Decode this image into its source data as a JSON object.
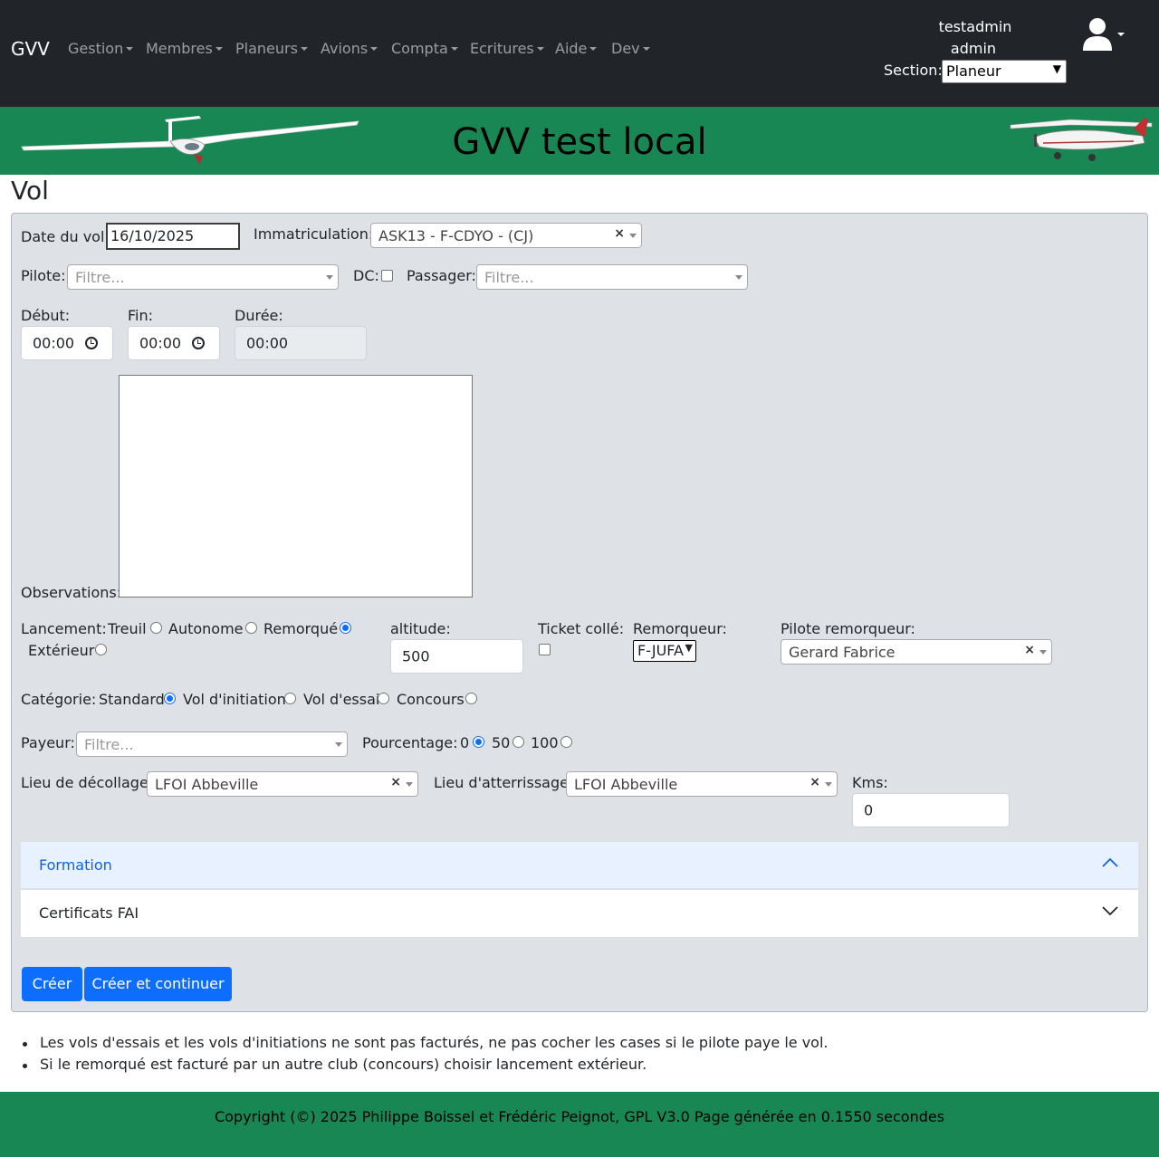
{
  "nav": {
    "brand": "GVV",
    "menus": [
      "Gestion",
      "Membres",
      "Planeurs",
      "Avions",
      "Compta",
      "Ecritures",
      "Aide",
      "Dev"
    ],
    "username": "testadmin",
    "role": "admin",
    "section_label": "Section:",
    "section_value": "Planeur",
    "user_icon": "user-icon"
  },
  "banner": {
    "title": "GVV test local"
  },
  "page_title": "Vol",
  "form": {
    "date_label": "Date du vol:",
    "date_value": "16/10/2025",
    "immat_label": "Immatriculation:",
    "immat_value": "ASK13 - F-CDYO - (CJ)",
    "pilote_label": "Pilote:",
    "pilote_placeholder": "Filtre...",
    "dc_label": "DC:",
    "passager_label": "Passager:",
    "passager_placeholder": "Filtre...",
    "debut_label": "Début:",
    "debut_value": "00:00",
    "fin_label": "Fin:",
    "fin_value": "00:00",
    "duree_label": "Durée:",
    "duree_value": "00:00",
    "observations_label": "Observations:",
    "lancement_label": "Lancement:",
    "lancement_options": [
      "Treuil",
      "Autonome",
      "Remorqué",
      "Extérieur"
    ],
    "lancement_selected": "Remorqué",
    "altitude_label": "altitude:",
    "altitude_value": "500",
    "ticket_label": "Ticket collé:",
    "remorqueur_label": "Remorqueur:",
    "remorqueur_value": "F-JUFA",
    "pilote_rem_label": "Pilote remorqueur:",
    "pilote_rem_value": "Gerard Fabrice",
    "categorie_label": "Catégorie:",
    "categorie_options": [
      "Standard",
      "Vol d'initiation",
      "Vol d'essai",
      "Concours"
    ],
    "categorie_selected": "Standard",
    "payeur_label": "Payeur:",
    "payeur_placeholder": "Filtre...",
    "pourcentage_label": "Pourcentage:",
    "pourcentage_options": [
      "0",
      "50",
      "100"
    ],
    "pourcentage_selected": "0",
    "decollage_label": "Lieu de décollage:",
    "decollage_value": "LFOI Abbeville",
    "atterrissage_label": "Lieu d'atterrissage:",
    "atterrissage_value": "LFOI Abbeville",
    "kms_label": "Kms:",
    "kms_value": "0"
  },
  "accordion": {
    "formation": "Formation",
    "certificats": "Certificats FAI"
  },
  "buttons": {
    "creer": "Créer",
    "creer_continuer": "Créer et continuer"
  },
  "notes": [
    "Les vols d'essais et les vols d'initiations ne sont pas facturés, ne pas cocher les cases si le pilote paye le vol.",
    "Si le remorqué est facturé par un autre club (concours) choisir lancement extérieur."
  ],
  "footer": "Copyright (©) 2025 Philippe Boissel et Frédéric Peignot, GPL V3.0 Page générée en 0.1550 secondes"
}
